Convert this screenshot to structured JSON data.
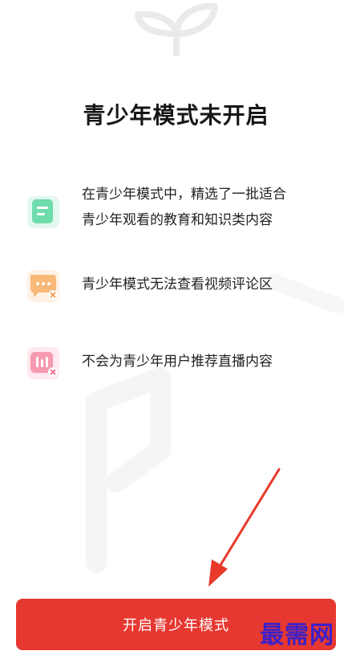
{
  "title": "青少年模式未开启",
  "features": [
    {
      "icon": "education-doc-icon",
      "lines": [
        "在青少年模式中，精选了一批适合",
        "青少年观看的教育和知识类内容"
      ]
    },
    {
      "icon": "no-comment-icon",
      "lines": [
        "青少年模式无法查看视频评论区"
      ]
    },
    {
      "icon": "no-live-icon",
      "lines": [
        "不会为青少年用户推荐直播内容"
      ]
    }
  ],
  "cta": {
    "label": "开启青少年模式",
    "color": "#e63831"
  },
  "watermark": "最需网",
  "colors": {
    "accent": "#e63831",
    "edu_icon": "#3ecf8e",
    "comment_icon": "#f5a24b",
    "live_icon": "#f2708a",
    "annotation_arrow": "#e8392b",
    "watermark": "#3d21c8"
  }
}
